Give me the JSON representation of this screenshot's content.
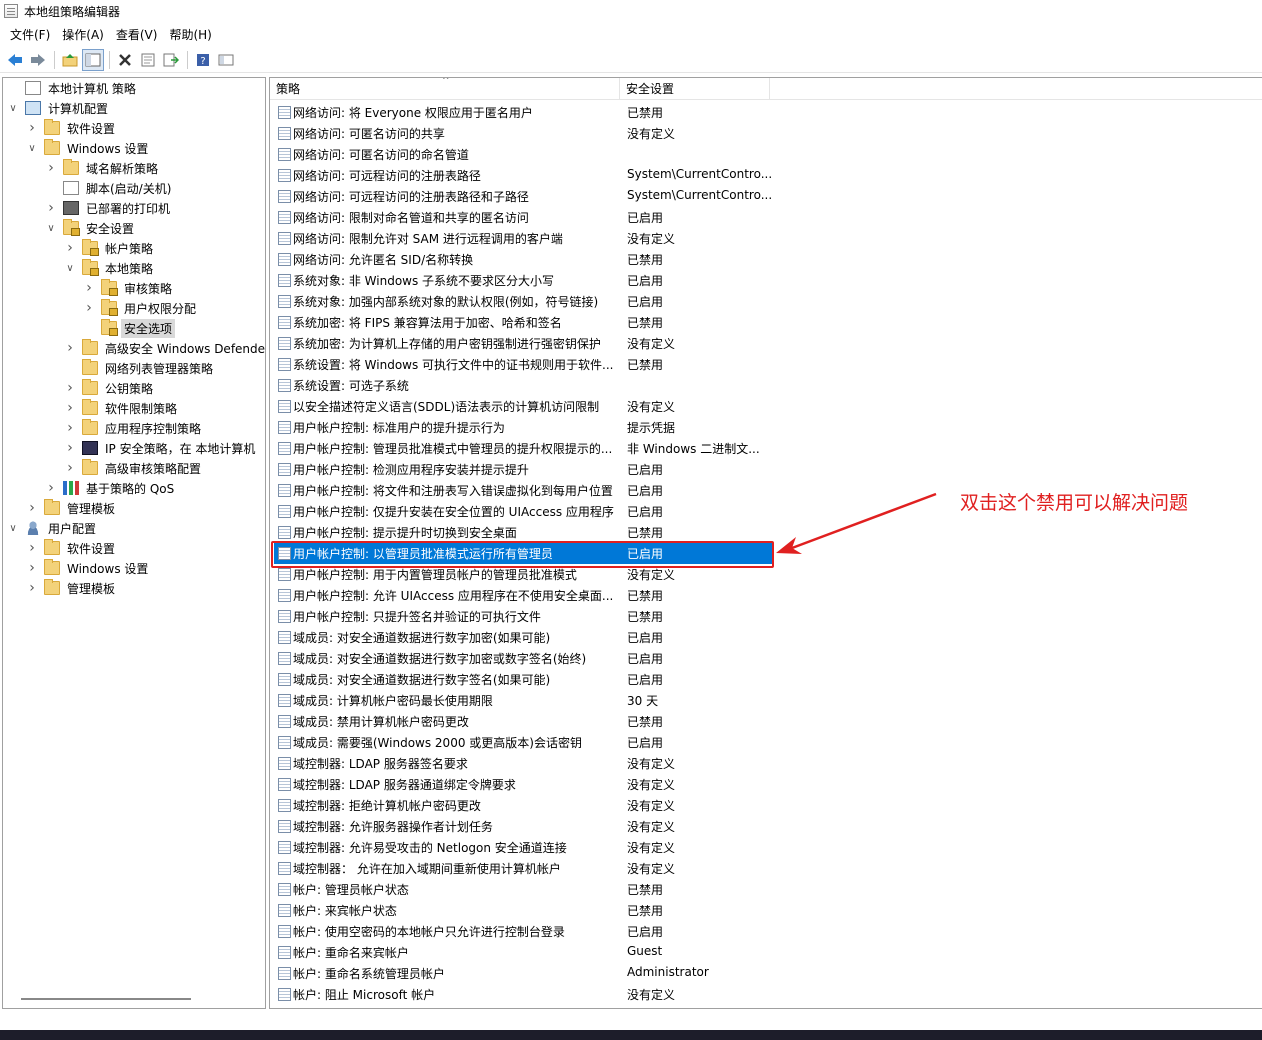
{
  "window": {
    "title": "本地组策略编辑器"
  },
  "menu": [
    "文件(F)",
    "操作(A)",
    "查看(V)",
    "帮助(H)"
  ],
  "toolbar_icons": [
    "back-icon",
    "forward-icon",
    "up-folder-icon",
    "show-hide-tree-icon",
    "delete-icon",
    "properties-icon",
    "export-list-icon",
    "help-icon",
    "view-icon"
  ],
  "tree": [
    {
      "label": "本地计算机 策略",
      "depth": 0,
      "twisty": "",
      "icon": "doc"
    },
    {
      "label": "计算机配置",
      "depth": 0,
      "twisty": "v",
      "icon": "computer"
    },
    {
      "label": "软件设置",
      "depth": 1,
      "twisty": ">",
      "icon": "folder"
    },
    {
      "label": "Windows 设置",
      "depth": 1,
      "twisty": "v",
      "icon": "folder"
    },
    {
      "label": "域名解析策略",
      "depth": 2,
      "twisty": ">",
      "icon": "folder"
    },
    {
      "label": "脚本(启动/关机)",
      "depth": 2,
      "twisty": "",
      "icon": "doc"
    },
    {
      "label": "已部署的打印机",
      "depth": 2,
      "twisty": ">",
      "icon": "printer"
    },
    {
      "label": "安全设置",
      "depth": 2,
      "twisty": "v",
      "icon": "lockfolder"
    },
    {
      "label": "帐户策略",
      "depth": 3,
      "twisty": ">",
      "icon": "lockfolder"
    },
    {
      "label": "本地策略",
      "depth": 3,
      "twisty": "v",
      "icon": "lockfolder"
    },
    {
      "label": "审核策略",
      "depth": 4,
      "twisty": ">",
      "icon": "lockfolder"
    },
    {
      "label": "用户权限分配",
      "depth": 4,
      "twisty": ">",
      "icon": "lockfolder"
    },
    {
      "label": "安全选项",
      "depth": 4,
      "twisty": "",
      "icon": "lockfolder",
      "selected": true
    },
    {
      "label": "高级安全 Windows Defender",
      "depth": 3,
      "twisty": ">",
      "icon": "folder"
    },
    {
      "label": "网络列表管理器策略",
      "depth": 3,
      "twisty": "",
      "icon": "folder"
    },
    {
      "label": "公钥策略",
      "depth": 3,
      "twisty": ">",
      "icon": "folder"
    },
    {
      "label": "软件限制策略",
      "depth": 3,
      "twisty": ">",
      "icon": "folder"
    },
    {
      "label": "应用程序控制策略",
      "depth": 3,
      "twisty": ">",
      "icon": "folder"
    },
    {
      "label": "IP 安全策略，在 本地计算机",
      "depth": 3,
      "twisty": ">",
      "icon": "ip"
    },
    {
      "label": "高级审核策略配置",
      "depth": 3,
      "twisty": ">",
      "icon": "folder"
    },
    {
      "label": "基于策略的 QoS",
      "depth": 2,
      "twisty": ">",
      "icon": "chart"
    },
    {
      "label": "管理模板",
      "depth": 1,
      "twisty": ">",
      "icon": "folder"
    },
    {
      "label": "用户配置",
      "depth": 0,
      "twisty": "v",
      "icon": "user"
    },
    {
      "label": "软件设置",
      "depth": 1,
      "twisty": ">",
      "icon": "folder"
    },
    {
      "label": "Windows 设置",
      "depth": 1,
      "twisty": ">",
      "icon": "folder"
    },
    {
      "label": "管理模板",
      "depth": 1,
      "twisty": ">",
      "icon": "folder"
    }
  ],
  "columns": {
    "policy": "策略",
    "setting": "安全设置"
  },
  "rows": [
    {
      "policy": "网络访问: 将 Everyone 权限应用于匿名用户",
      "setting": "已禁用"
    },
    {
      "policy": "网络访问: 可匿名访问的共享",
      "setting": "没有定义"
    },
    {
      "policy": "网络访问: 可匿名访问的命名管道",
      "setting": ""
    },
    {
      "policy": "网络访问: 可远程访问的注册表路径",
      "setting": "System\\CurrentContro..."
    },
    {
      "policy": "网络访问: 可远程访问的注册表路径和子路径",
      "setting": "System\\CurrentContro..."
    },
    {
      "policy": "网络访问: 限制对命名管道和共享的匿名访问",
      "setting": "已启用"
    },
    {
      "policy": "网络访问: 限制允许对 SAM 进行远程调用的客户端",
      "setting": "没有定义"
    },
    {
      "policy": "网络访问: 允许匿名 SID/名称转换",
      "setting": "已禁用"
    },
    {
      "policy": "系统对象: 非 Windows 子系统不要求区分大小写",
      "setting": "已启用"
    },
    {
      "policy": "系统对象: 加强内部系统对象的默认权限(例如，符号链接)",
      "setting": "已启用"
    },
    {
      "policy": "系统加密: 将 FIPS 兼容算法用于加密、哈希和签名",
      "setting": "已禁用"
    },
    {
      "policy": "系统加密: 为计算机上存储的用户密钥强制进行强密钥保护",
      "setting": "没有定义"
    },
    {
      "policy": "系统设置: 将 Windows 可执行文件中的证书规则用于软件...",
      "setting": "已禁用"
    },
    {
      "policy": "系统设置: 可选子系统",
      "setting": ""
    },
    {
      "policy": "以安全描述符定义语言(SDDL)语法表示的计算机访问限制",
      "setting": "没有定义"
    },
    {
      "policy": "用户帐户控制: 标准用户的提升提示行为",
      "setting": "提示凭据"
    },
    {
      "policy": "用户帐户控制: 管理员批准模式中管理员的提升权限提示的...",
      "setting": "非 Windows 二进制文..."
    },
    {
      "policy": "用户帐户控制: 检测应用程序安装并提示提升",
      "setting": "已启用"
    },
    {
      "policy": "用户帐户控制: 将文件和注册表写入错误虚拟化到每用户位置",
      "setting": "已启用"
    },
    {
      "policy": "用户帐户控制: 仅提升安装在安全位置的 UIAccess 应用程序",
      "setting": "已启用"
    },
    {
      "policy": "用户帐户控制: 提示提升时切换到安全桌面",
      "setting": "已禁用"
    },
    {
      "policy": "用户帐户控制: 以管理员批准模式运行所有管理员",
      "setting": "已启用",
      "selected": true
    },
    {
      "policy": "用户帐户控制: 用于内置管理员帐户的管理员批准模式",
      "setting": "没有定义"
    },
    {
      "policy": "用户帐户控制: 允许 UIAccess 应用程序在不使用安全桌面...",
      "setting": "已禁用"
    },
    {
      "policy": "用户帐户控制: 只提升签名并验证的可执行文件",
      "setting": "已禁用"
    },
    {
      "policy": "域成员: 对安全通道数据进行数字加密(如果可能)",
      "setting": "已启用"
    },
    {
      "policy": "域成员: 对安全通道数据进行数字加密或数字签名(始终)",
      "setting": "已启用"
    },
    {
      "policy": "域成员: 对安全通道数据进行数字签名(如果可能)",
      "setting": "已启用"
    },
    {
      "policy": "域成员: 计算机帐户密码最长使用期限",
      "setting": "30 天"
    },
    {
      "policy": "域成员: 禁用计算机帐户密码更改",
      "setting": "已禁用"
    },
    {
      "policy": "域成员: 需要强(Windows 2000 或更高版本)会话密钥",
      "setting": "已启用"
    },
    {
      "policy": "域控制器: LDAP 服务器签名要求",
      "setting": "没有定义"
    },
    {
      "policy": "域控制器: LDAP 服务器通道绑定令牌要求",
      "setting": "没有定义"
    },
    {
      "policy": "域控制器: 拒绝计算机帐户密码更改",
      "setting": "没有定义"
    },
    {
      "policy": "域控制器: 允许服务器操作者计划任务",
      "setting": "没有定义"
    },
    {
      "policy": "域控制器: 允许易受攻击的 Netlogon 安全通道连接",
      "setting": "没有定义"
    },
    {
      "policy": "域控制器： 允许在加入域期间重新使用计算机帐户",
      "setting": "没有定义"
    },
    {
      "policy": "帐户: 管理员帐户状态",
      "setting": "已禁用"
    },
    {
      "policy": "帐户: 来宾帐户状态",
      "setting": "已禁用"
    },
    {
      "policy": "帐户: 使用空密码的本地帐户只允许进行控制台登录",
      "setting": "已启用"
    },
    {
      "policy": "帐户: 重命名来宾帐户",
      "setting": "Guest"
    },
    {
      "policy": "帐户: 重命名系统管理员帐户",
      "setting": "Administrator"
    },
    {
      "policy": "帐户: 阻止 Microsoft 帐户",
      "setting": "没有定义"
    }
  ],
  "annotation": {
    "text": "双击这个禁用可以解决问题",
    "color": "#e02020"
  },
  "colors": {
    "selection": "#0078d7",
    "annotation_red": "#e02020"
  }
}
